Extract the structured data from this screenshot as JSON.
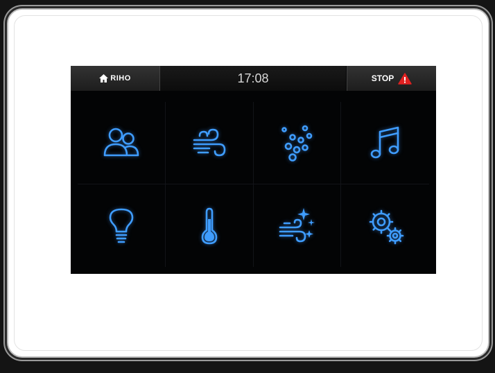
{
  "topbar": {
    "home_label": "RIHO",
    "clock": "17:08",
    "stop_label": "STOP"
  },
  "tiles": [
    {
      "icon": "users-icon"
    },
    {
      "icon": "wind-icon"
    },
    {
      "icon": "bubbles-icon"
    },
    {
      "icon": "music-note-icon"
    },
    {
      "icon": "light-bulb-icon"
    },
    {
      "icon": "thermometer-icon"
    },
    {
      "icon": "aroma-wind-icon"
    },
    {
      "icon": "settings-gears-icon"
    }
  ],
  "colors": {
    "icon_accent": "#3f9dff",
    "stop_warning": "#e02020",
    "screen_background": "#030405",
    "bezel": "#ffffff"
  }
}
